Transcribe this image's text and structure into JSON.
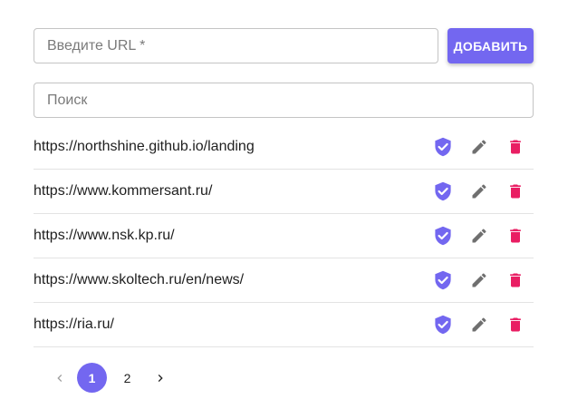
{
  "form": {
    "url_placeholder": "Введите URL *",
    "url_value": "",
    "add_label": "ДОБАВИТЬ"
  },
  "search": {
    "placeholder": "Поиск",
    "value": ""
  },
  "urls": [
    {
      "url": "https://northshine.github.io/landing"
    },
    {
      "url": "https://www.kommersant.ru/"
    },
    {
      "url": "https://www.nsk.kp.ru/"
    },
    {
      "url": "https://www.skoltech.ru/en/news/"
    },
    {
      "url": "https://ria.ru/"
    }
  ],
  "row_icons": [
    "verified-shield-icon",
    "edit-pencil-icon",
    "delete-trash-icon"
  ],
  "pagination": {
    "pages": [
      "1",
      "2"
    ],
    "current": "1"
  },
  "colors": {
    "accent": "#7367f0",
    "delete": "#e91e63",
    "edit": "#6f6f6f"
  }
}
